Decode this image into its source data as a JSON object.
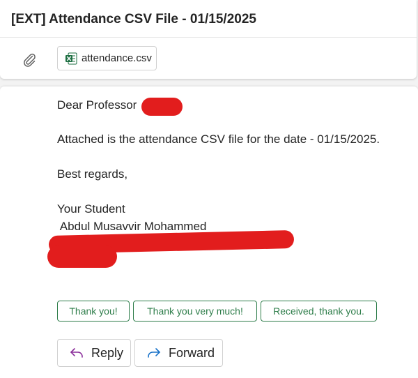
{
  "message": {
    "subject": "[EXT] Attendance CSV File - 01/15/2025",
    "attachment": {
      "file_name": "attendance.csv",
      "icon": "excel-csv-icon"
    },
    "body": {
      "greeting": "Dear Professor",
      "paragraph": "Attached is the attendance CSV file for the date - 01/15/2025.",
      "closing": "Best regards,",
      "signature_line_1": "Your Student",
      "signature_line_2": " Abdul Musavvir Mohammed"
    }
  },
  "quick_replies": [
    "Thank you!",
    "Thank you very much!",
    "Received, thank you."
  ],
  "actions": {
    "reply_label": "Reply",
    "forward_label": "Forward"
  },
  "colors": {
    "redaction": "#e21d1d",
    "quick_reply_accent": "#2e7d4a",
    "reply_icon": "#8a2d9a",
    "forward_icon": "#1a73c9",
    "excel_green": "#1d6f42"
  }
}
